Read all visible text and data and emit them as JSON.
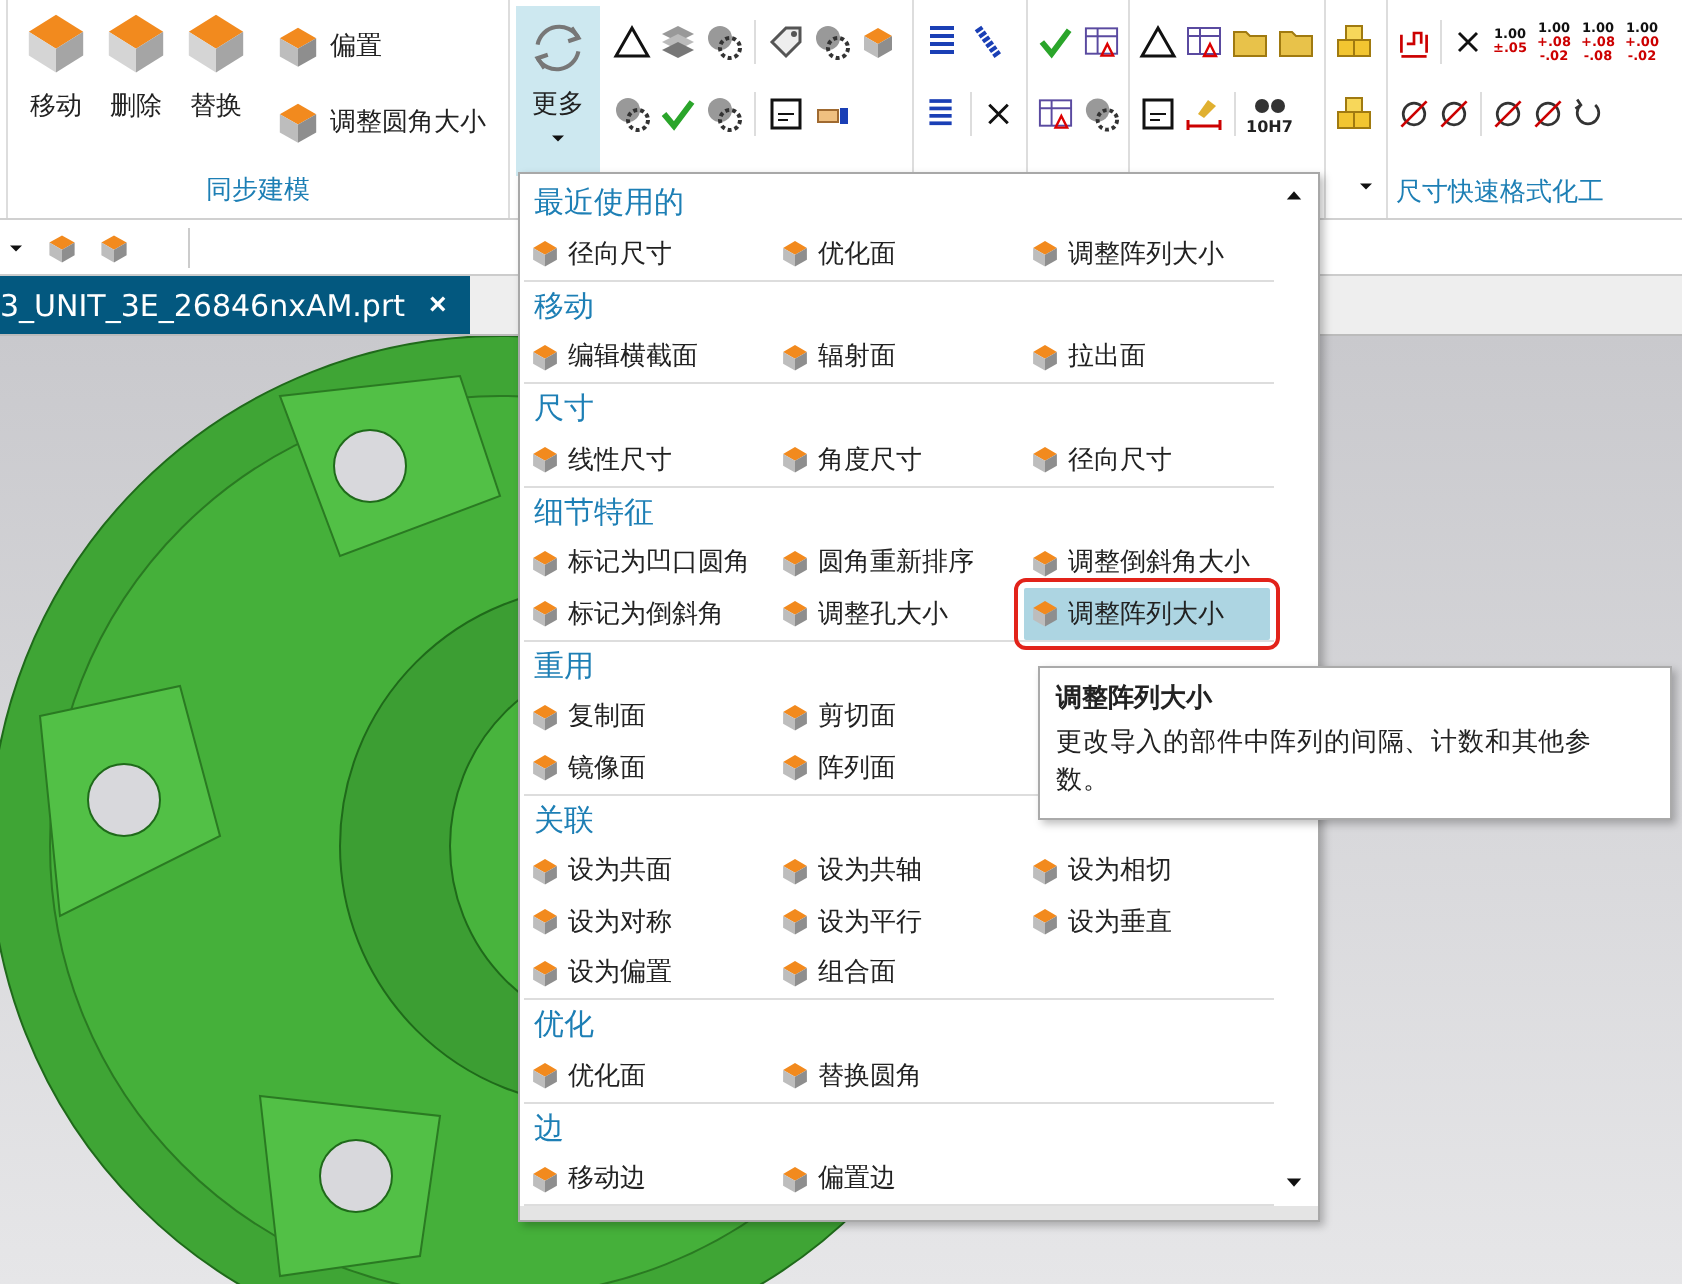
{
  "ribbon": {
    "group": {
      "label": "同步建模",
      "large_buttons": [
        "移动",
        "删除",
        "替换"
      ],
      "small_buttons": [
        "偏置",
        "调整圆角大小"
      ]
    },
    "more_button": {
      "label": "更多",
      "open": true
    },
    "dimension_formats": [
      {
        "value": "1.00",
        "tolerance": [
          "±.05"
        ]
      },
      {
        "value": "1.00",
        "tolerance": [
          "+.08",
          "-.02"
        ]
      },
      {
        "value": "1.00",
        "tolerance": [
          "+.08",
          "-.08"
        ]
      },
      {
        "value": "1.00",
        "tolerance": [
          "+.00",
          "-.02"
        ]
      }
    ],
    "fit_label": "10H7",
    "right_group_label": "尺寸快速格式化工"
  },
  "tab": {
    "title": "3_UNIT_3E_26846nxAM.prt",
    "close": "×",
    "selected": true
  },
  "menu": {
    "sections": [
      {
        "title": "最近使用的",
        "rows": [
          [
            {
              "label": "径向尺寸",
              "selected": false
            },
            {
              "label": "优化面",
              "selected": false
            },
            {
              "label": "调整阵列大小",
              "selected": false
            }
          ]
        ]
      },
      {
        "title": "移动",
        "rows": [
          [
            {
              "label": "编辑横截面",
              "selected": false
            },
            {
              "label": "辐射面",
              "selected": false
            },
            {
              "label": "拉出面",
              "selected": false
            }
          ]
        ]
      },
      {
        "title": "尺寸",
        "rows": [
          [
            {
              "label": "线性尺寸",
              "selected": false
            },
            {
              "label": "角度尺寸",
              "selected": false
            },
            {
              "label": "径向尺寸",
              "selected": false
            }
          ]
        ]
      },
      {
        "title": "细节特征",
        "rows": [
          [
            {
              "label": "标记为凹口圆角",
              "selected": false
            },
            {
              "label": "圆角重新排序",
              "selected": false
            },
            {
              "label": "调整倒斜角大小",
              "selected": false
            }
          ],
          [
            {
              "label": "标记为倒斜角",
              "selected": false
            },
            {
              "label": "调整孔大小",
              "selected": false
            },
            {
              "label": "调整阵列大小",
              "selected": true
            }
          ]
        ]
      },
      {
        "title": "重用",
        "rows": [
          [
            {
              "label": "复制面",
              "selected": false
            },
            {
              "label": "剪切面",
              "selected": false
            }
          ],
          [
            {
              "label": "镜像面",
              "selected": false
            },
            {
              "label": "阵列面",
              "selected": false
            }
          ]
        ]
      },
      {
        "title": "关联",
        "rows": [
          [
            {
              "label": "设为共面",
              "selected": false
            },
            {
              "label": "设为共轴",
              "selected": false
            },
            {
              "label": "设为相切",
              "selected": false
            }
          ],
          [
            {
              "label": "设为对称",
              "selected": false
            },
            {
              "label": "设为平行",
              "selected": false
            },
            {
              "label": "设为垂直",
              "selected": false
            }
          ],
          [
            {
              "label": "设为偏置",
              "selected": false
            },
            {
              "label": "组合面",
              "selected": false
            }
          ]
        ]
      },
      {
        "title": "优化",
        "rows": [
          [
            {
              "label": "优化面",
              "selected": false
            },
            {
              "label": "替换圆角",
              "selected": false
            }
          ]
        ]
      },
      {
        "title": "边",
        "rows": [
          [
            {
              "label": "移动边",
              "selected": false
            },
            {
              "label": "偏置边",
              "selected": false
            }
          ]
        ]
      }
    ]
  },
  "tooltip": {
    "title": "调整阵列大小",
    "text": "更改导入的部件中阵列的间隔、计数和其他参数。"
  }
}
